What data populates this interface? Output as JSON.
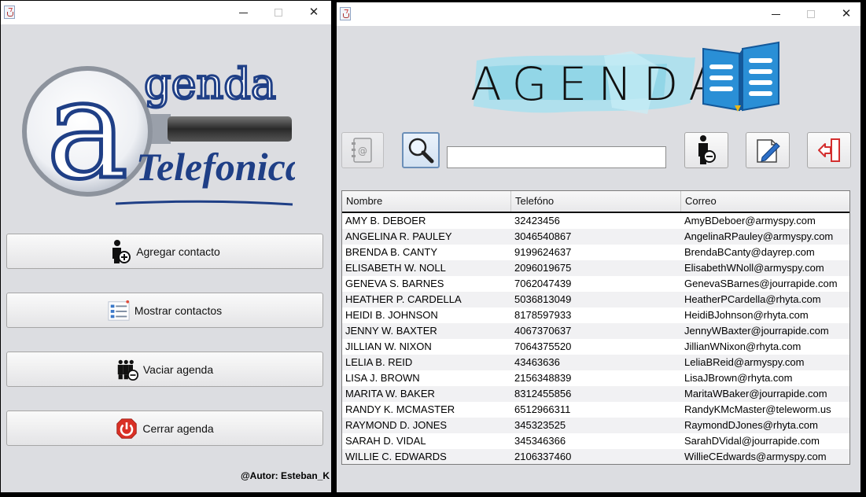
{
  "left_window": {
    "title": "",
    "logo": {
      "letter": "a",
      "word1": "genda",
      "word2": "Telefonica"
    },
    "buttons": [
      {
        "label": "Agregar contacto",
        "icon": "add-user-icon"
      },
      {
        "label": "Mostrar contactos",
        "icon": "list-icon"
      },
      {
        "label": "Vaciar agenda",
        "icon": "remove-group-icon"
      },
      {
        "label": "Cerrar agenda",
        "icon": "power-icon"
      }
    ],
    "author": "@Autor: Esteban_K"
  },
  "right_window": {
    "title": "",
    "brand": "AGENDA",
    "search": {
      "value": "",
      "placeholder": ""
    },
    "toolbar": [
      "contacts-book-icon",
      "search-icon",
      "remove-user-icon",
      "edit-icon",
      "exit-icon"
    ],
    "table": {
      "columns": [
        "Nombre",
        "Telefóno",
        "Correo"
      ],
      "rows": [
        [
          "AMY B. DEBOER",
          "32423456",
          "AmyBDeboer@armyspy.com"
        ],
        [
          "ANGELINA R. PAULEY",
          "3046540867",
          "AngelinaRPauley@armyspy.com"
        ],
        [
          "BRENDA B. CANTY",
          "9199624637",
          "BrendaBCanty@dayrep.com"
        ],
        [
          "ELISABETH W. NOLL",
          "2096019675",
          "ElisabethWNoll@armyspy.com"
        ],
        [
          "GENEVA S. BARNES",
          "7062047439",
          "GenevaSBarnes@jourrapide.com"
        ],
        [
          "HEATHER P. CARDELLA",
          "5036813049",
          "HeatherPCardella@rhyta.com"
        ],
        [
          "HEIDI B. JOHNSON",
          "8178597933",
          "HeidiBJohnson@rhyta.com"
        ],
        [
          "JENNY W. BAXTER",
          "4067370637",
          "JennyWBaxter@jourrapide.com"
        ],
        [
          "JILLIAN W. NIXON",
          "7064375520",
          "JillianWNixon@rhyta.com"
        ],
        [
          "LELIA B. REID",
          "43463636",
          "LeliaBReid@armyspy.com"
        ],
        [
          "LISA J. BROWN",
          "2156348839",
          "LisaJBrown@rhyta.com"
        ],
        [
          "MARITA W. BAKER",
          "8312455856",
          "MaritaWBaker@jourrapide.com"
        ],
        [
          "RANDY K. MCMASTER",
          "6512966311",
          "RandyKMcMaster@teleworm.us"
        ],
        [
          "RAYMOND D. JONES",
          "345323525",
          "RaymondDJones@rhyta.com"
        ],
        [
          "SARAH D. VIDAL",
          "345346366",
          "SarahDVidal@jourrapide.com"
        ],
        [
          "WILLIE C. EDWARDS",
          "2106337460",
          "WillieCEdwards@armyspy.com"
        ]
      ]
    }
  },
  "colors": {
    "window_bg": "#dcdde1",
    "logo_blue": "#1f3f86",
    "brand_accent": "#8fd6e8",
    "book_blue": "#2a8fd6",
    "power_red": "#d93025"
  }
}
